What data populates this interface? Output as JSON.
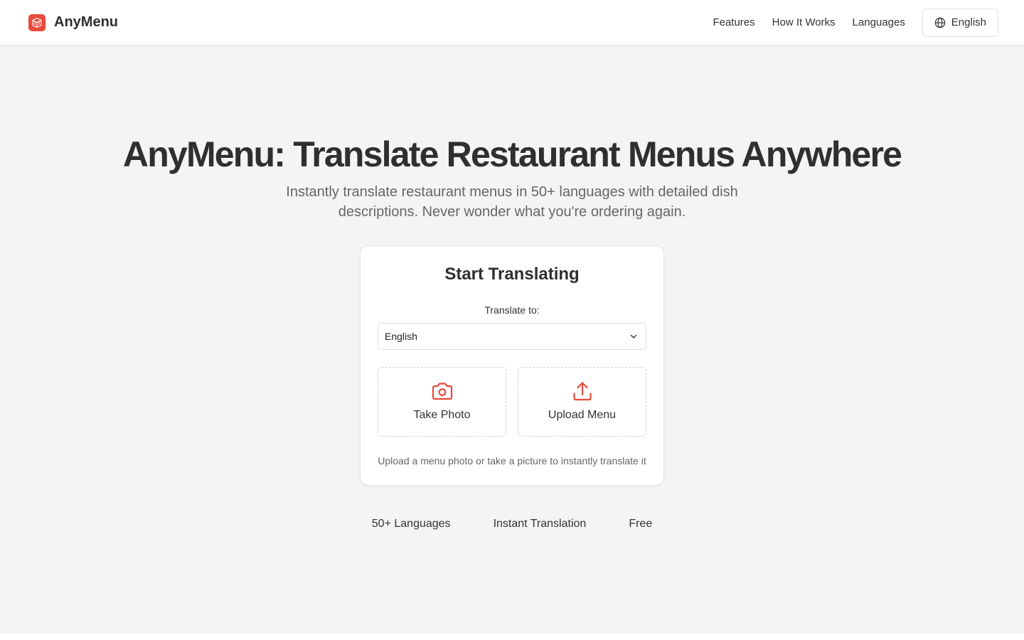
{
  "header": {
    "brand": "AnyMenu",
    "nav": [
      "Features",
      "How It Works",
      "Languages"
    ],
    "language_button": "English"
  },
  "hero": {
    "title": "AnyMenu: Translate Restaurant Menus Anywhere",
    "subtitle": "Instantly translate restaurant menus in 50+ languages with detailed dish descriptions. Never wonder what you're ordering again."
  },
  "card": {
    "title": "Start Translating",
    "select_label": "Translate to:",
    "selected_language": "English",
    "take_photo": "Take Photo",
    "upload_menu": "Upload Menu",
    "hint": "Upload a menu photo or take a picture to instantly translate it"
  },
  "features": [
    "50+ Languages",
    "Instant Translation",
    "Free"
  ],
  "colors": {
    "accent": "#e84a3c",
    "background": "#f4f4f4",
    "text": "#2f2f2f"
  },
  "icons": {
    "logo": "menu-logo-icon",
    "language": "globe-icon",
    "select": "chevron-down-icon",
    "take_photo": "camera-icon",
    "upload": "upload-icon"
  }
}
